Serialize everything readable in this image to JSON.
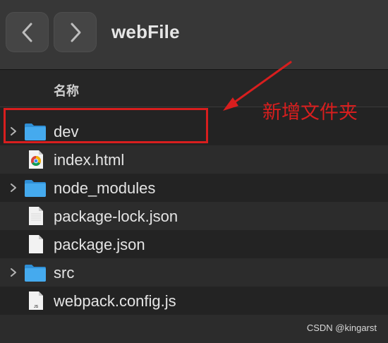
{
  "window": {
    "title": "webFile"
  },
  "toolbar": {
    "back_icon": "chevron-left-icon",
    "forward_icon": "chevron-right-icon"
  },
  "list": {
    "column_header": "名称",
    "items": [
      {
        "name": "dev",
        "kind": "folder",
        "icon": "folder-icon",
        "expandable": true
      },
      {
        "name": "index.html",
        "kind": "html",
        "icon": "chrome-document-icon",
        "expandable": false
      },
      {
        "name": "node_modules",
        "kind": "folder",
        "icon": "folder-icon",
        "expandable": true
      },
      {
        "name": "package-lock.json",
        "kind": "file",
        "icon": "document-icon",
        "expandable": false
      },
      {
        "name": "package.json",
        "kind": "file",
        "icon": "document-icon",
        "expandable": false
      },
      {
        "name": "src",
        "kind": "folder",
        "icon": "folder-icon",
        "expandable": true
      },
      {
        "name": "webpack.config.js",
        "kind": "js",
        "icon": "js-document-icon",
        "expandable": false
      }
    ]
  },
  "annotation": {
    "text": "新增文件夹",
    "color": "#d81e1e"
  },
  "watermark": "CSDN @kingarst",
  "colors": {
    "folder": "#3ea2e6",
    "accent": "#d81e1e"
  }
}
